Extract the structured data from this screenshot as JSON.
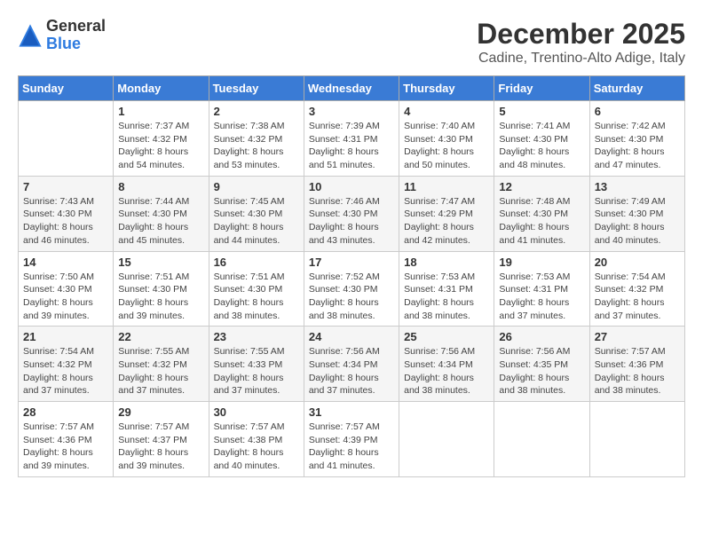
{
  "logo": {
    "general": "General",
    "blue": "Blue"
  },
  "header": {
    "month": "December 2025",
    "location": "Cadine, Trentino-Alto Adige, Italy"
  },
  "weekdays": [
    "Sunday",
    "Monday",
    "Tuesday",
    "Wednesday",
    "Thursday",
    "Friday",
    "Saturday"
  ],
  "weeks": [
    [
      {
        "day": "",
        "info": ""
      },
      {
        "day": "1",
        "info": "Sunrise: 7:37 AM\nSunset: 4:32 PM\nDaylight: 8 hours\nand 54 minutes."
      },
      {
        "day": "2",
        "info": "Sunrise: 7:38 AM\nSunset: 4:32 PM\nDaylight: 8 hours\nand 53 minutes."
      },
      {
        "day": "3",
        "info": "Sunrise: 7:39 AM\nSunset: 4:31 PM\nDaylight: 8 hours\nand 51 minutes."
      },
      {
        "day": "4",
        "info": "Sunrise: 7:40 AM\nSunset: 4:30 PM\nDaylight: 8 hours\nand 50 minutes."
      },
      {
        "day": "5",
        "info": "Sunrise: 7:41 AM\nSunset: 4:30 PM\nDaylight: 8 hours\nand 48 minutes."
      },
      {
        "day": "6",
        "info": "Sunrise: 7:42 AM\nSunset: 4:30 PM\nDaylight: 8 hours\nand 47 minutes."
      }
    ],
    [
      {
        "day": "7",
        "info": "Sunrise: 7:43 AM\nSunset: 4:30 PM\nDaylight: 8 hours\nand 46 minutes."
      },
      {
        "day": "8",
        "info": "Sunrise: 7:44 AM\nSunset: 4:30 PM\nDaylight: 8 hours\nand 45 minutes."
      },
      {
        "day": "9",
        "info": "Sunrise: 7:45 AM\nSunset: 4:30 PM\nDaylight: 8 hours\nand 44 minutes."
      },
      {
        "day": "10",
        "info": "Sunrise: 7:46 AM\nSunset: 4:30 PM\nDaylight: 8 hours\nand 43 minutes."
      },
      {
        "day": "11",
        "info": "Sunrise: 7:47 AM\nSunset: 4:29 PM\nDaylight: 8 hours\nand 42 minutes."
      },
      {
        "day": "12",
        "info": "Sunrise: 7:48 AM\nSunset: 4:30 PM\nDaylight: 8 hours\nand 41 minutes."
      },
      {
        "day": "13",
        "info": "Sunrise: 7:49 AM\nSunset: 4:30 PM\nDaylight: 8 hours\nand 40 minutes."
      }
    ],
    [
      {
        "day": "14",
        "info": "Sunrise: 7:50 AM\nSunset: 4:30 PM\nDaylight: 8 hours\nand 39 minutes."
      },
      {
        "day": "15",
        "info": "Sunrise: 7:51 AM\nSunset: 4:30 PM\nDaylight: 8 hours\nand 39 minutes."
      },
      {
        "day": "16",
        "info": "Sunrise: 7:51 AM\nSunset: 4:30 PM\nDaylight: 8 hours\nand 38 minutes."
      },
      {
        "day": "17",
        "info": "Sunrise: 7:52 AM\nSunset: 4:30 PM\nDaylight: 8 hours\nand 38 minutes."
      },
      {
        "day": "18",
        "info": "Sunrise: 7:53 AM\nSunset: 4:31 PM\nDaylight: 8 hours\nand 38 minutes."
      },
      {
        "day": "19",
        "info": "Sunrise: 7:53 AM\nSunset: 4:31 PM\nDaylight: 8 hours\nand 37 minutes."
      },
      {
        "day": "20",
        "info": "Sunrise: 7:54 AM\nSunset: 4:32 PM\nDaylight: 8 hours\nand 37 minutes."
      }
    ],
    [
      {
        "day": "21",
        "info": "Sunrise: 7:54 AM\nSunset: 4:32 PM\nDaylight: 8 hours\nand 37 minutes."
      },
      {
        "day": "22",
        "info": "Sunrise: 7:55 AM\nSunset: 4:32 PM\nDaylight: 8 hours\nand 37 minutes."
      },
      {
        "day": "23",
        "info": "Sunrise: 7:55 AM\nSunset: 4:33 PM\nDaylight: 8 hours\nand 37 minutes."
      },
      {
        "day": "24",
        "info": "Sunrise: 7:56 AM\nSunset: 4:34 PM\nDaylight: 8 hours\nand 37 minutes."
      },
      {
        "day": "25",
        "info": "Sunrise: 7:56 AM\nSunset: 4:34 PM\nDaylight: 8 hours\nand 38 minutes."
      },
      {
        "day": "26",
        "info": "Sunrise: 7:56 AM\nSunset: 4:35 PM\nDaylight: 8 hours\nand 38 minutes."
      },
      {
        "day": "27",
        "info": "Sunrise: 7:57 AM\nSunset: 4:36 PM\nDaylight: 8 hours\nand 38 minutes."
      }
    ],
    [
      {
        "day": "28",
        "info": "Sunrise: 7:57 AM\nSunset: 4:36 PM\nDaylight: 8 hours\nand 39 minutes."
      },
      {
        "day": "29",
        "info": "Sunrise: 7:57 AM\nSunset: 4:37 PM\nDaylight: 8 hours\nand 39 minutes."
      },
      {
        "day": "30",
        "info": "Sunrise: 7:57 AM\nSunset: 4:38 PM\nDaylight: 8 hours\nand 40 minutes."
      },
      {
        "day": "31",
        "info": "Sunrise: 7:57 AM\nSunset: 4:39 PM\nDaylight: 8 hours\nand 41 minutes."
      },
      {
        "day": "",
        "info": ""
      },
      {
        "day": "",
        "info": ""
      },
      {
        "day": "",
        "info": ""
      }
    ]
  ]
}
